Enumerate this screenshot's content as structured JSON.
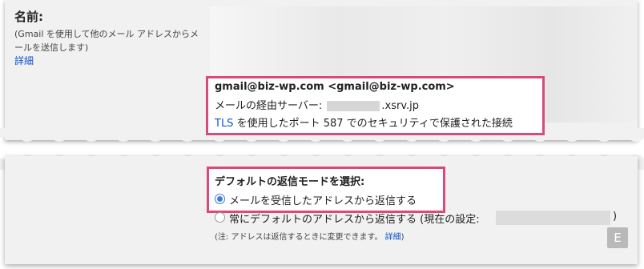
{
  "name_section": {
    "title": "名前:",
    "note": "(Gmail を使用して他のメール アドレスからメールを送信します)",
    "detail_link": "詳細"
  },
  "sender_box": {
    "address": "gmail@biz-wp.com <gmail@biz-wp.com>",
    "relay_label": "メールの経由サーバー:",
    "relay_domain": ".xsrv.jp",
    "tls_link": "TLS",
    "tls_text": "を使用したポート 587 でのセキュリティで保護された接続"
  },
  "reply_section": {
    "title": "デフォルトの返信モードを選択:",
    "option1": "メールを受信したアドレスから返信する",
    "option2_prefix": "常にデフォルトのアドレスから返信する (現在の設定:",
    "option2_suffix": ")",
    "note": "(注: アドレスは返信するときに変更できます。",
    "note_link": "詳細",
    "note_suffix": ")"
  },
  "badge": "E",
  "colors": {
    "highlight": "#d84a7e",
    "link": "#1155cc",
    "radio": "#3b7ddd"
  }
}
